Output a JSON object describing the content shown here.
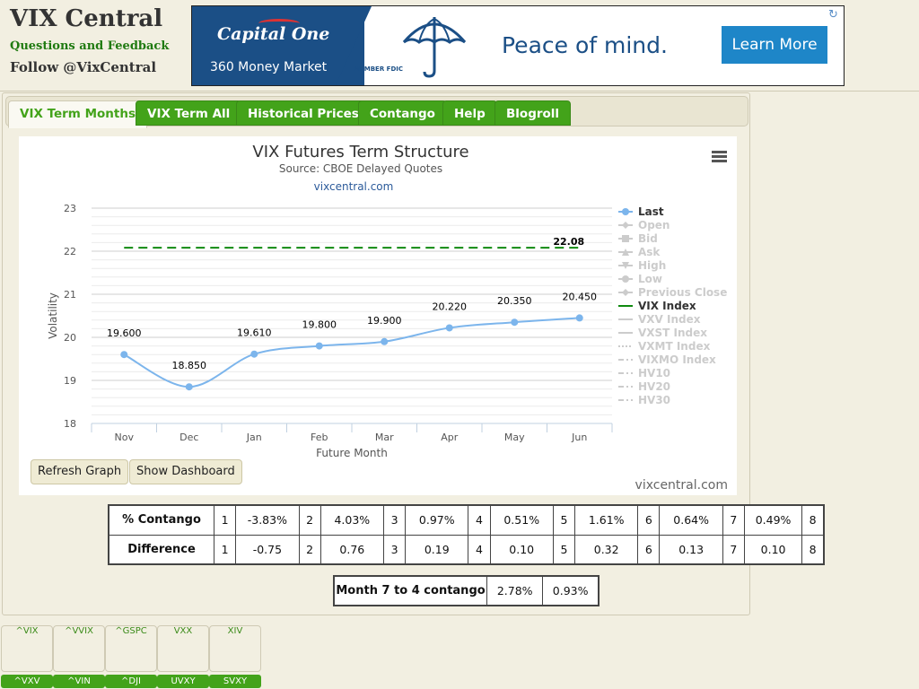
{
  "header": {
    "title": "VIX Central",
    "feedback": "Questions and Feedback",
    "follow": "Follow @VixCentral"
  },
  "ad": {
    "brand": "Capital One",
    "product": "360 Money Market",
    "fdic": "MEMBER FDIC",
    "tagline": "Peace of mind.",
    "cta": "Learn More",
    "info_icon": "ad-choices-icon"
  },
  "tabs": [
    {
      "label": "VIX Term Months",
      "active": true
    },
    {
      "label": "VIX Term All"
    },
    {
      "label": "Historical Prices"
    },
    {
      "label": "Contango"
    },
    {
      "label": "Help"
    },
    {
      "label": "Blogroll"
    }
  ],
  "buttons": {
    "refresh": "Refresh Graph",
    "dashboard": "Show Dashboard",
    "menu_icon": "hamburger-menu-icon"
  },
  "credits": "vixcentral.com",
  "chart_data": {
    "type": "line",
    "title": "VIX Futures Term Structure",
    "subtitle": "Source: CBOE Delayed Quotes",
    "watermark": "vixcentral.com",
    "xlabel": "Future Month",
    "ylabel": "Volatility",
    "categories": [
      "Nov",
      "Dec",
      "Jan",
      "Feb",
      "Mar",
      "Apr",
      "May",
      "Jun"
    ],
    "ylim": [
      18,
      23
    ],
    "yticks": [
      18,
      19,
      20,
      21,
      22,
      23
    ],
    "grid": true,
    "legend_position": "right",
    "series": [
      {
        "name": "Last",
        "color": "#7cb5ec",
        "values": [
          19.6,
          18.85,
          19.61,
          19.8,
          19.9,
          20.22,
          20.35,
          20.45
        ],
        "labels": [
          "19.600",
          "18.850",
          "19.610",
          "19.800",
          "19.900",
          "20.220",
          "20.350",
          "20.450"
        ]
      },
      {
        "name": "VIX Index",
        "color": "#108a10",
        "style": "dashed",
        "value": 22.08,
        "label": "22.08"
      }
    ],
    "legend": [
      {
        "name": "Last",
        "active": true,
        "marker": "circle"
      },
      {
        "name": "Open",
        "active": false,
        "marker": "diamond"
      },
      {
        "name": "Bid",
        "active": false,
        "marker": "square"
      },
      {
        "name": "Ask",
        "active": false,
        "marker": "triangle"
      },
      {
        "name": "High",
        "active": false,
        "marker": "triangle-down"
      },
      {
        "name": "Low",
        "active": false,
        "marker": "circle"
      },
      {
        "name": "Previous Close",
        "active": false,
        "marker": "diamond"
      },
      {
        "name": "VIX Index",
        "active": true,
        "marker": "line"
      },
      {
        "name": "VXV Index",
        "active": false,
        "marker": "line"
      },
      {
        "name": "VXST Index",
        "active": false,
        "marker": "line"
      },
      {
        "name": "VXMT Index",
        "active": false,
        "marker": "dotted"
      },
      {
        "name": "VIXMO Index",
        "active": false,
        "marker": "dashdot"
      },
      {
        "name": "HV10",
        "active": false,
        "marker": "dashdot"
      },
      {
        "name": "HV20",
        "active": false,
        "marker": "dashdot"
      },
      {
        "name": "HV30",
        "active": false,
        "marker": "dashdot"
      }
    ]
  },
  "contango_table": {
    "rows": [
      {
        "label": "% Contango",
        "cells": [
          "1",
          "-3.83%",
          "2",
          "4.03%",
          "3",
          "0.97%",
          "4",
          "0.51%",
          "5",
          "1.61%",
          "6",
          "0.64%",
          "7",
          "0.49%",
          "8"
        ]
      },
      {
        "label": "Difference",
        "cells": [
          "1",
          "-0.75",
          "2",
          "0.76",
          "3",
          "0.19",
          "4",
          "0.10",
          "5",
          "0.32",
          "6",
          "0.13",
          "7",
          "0.10",
          "8"
        ]
      }
    ]
  },
  "m74_table": {
    "label": "Month 7 to 4 contango",
    "values": [
      "2.78%",
      "0.93%"
    ]
  },
  "tickers": [
    {
      "top": "^VIX",
      "bottom": "^VXV"
    },
    {
      "top": "^VVIX",
      "bottom": "^VIN"
    },
    {
      "top": "^GSPC",
      "bottom": "^DJI"
    },
    {
      "top": "VXX",
      "bottom": "UVXY"
    },
    {
      "top": "XIV",
      "bottom": "SVXY"
    }
  ]
}
